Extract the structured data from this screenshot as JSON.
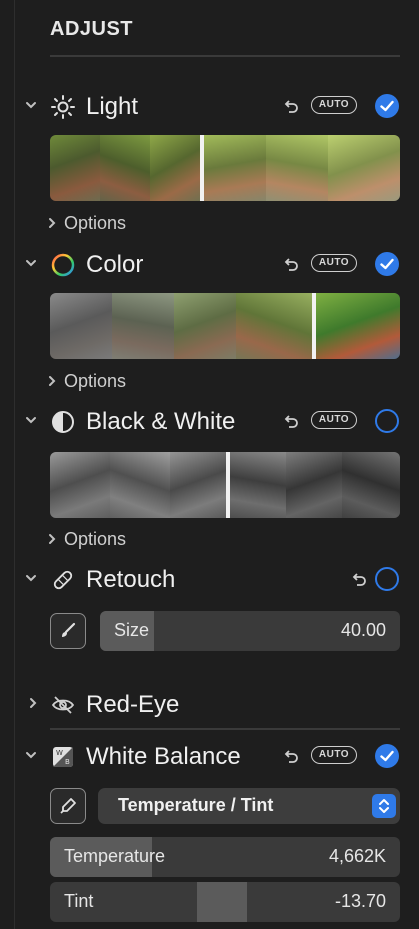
{
  "panel": {
    "title": "ADJUST"
  },
  "sections": {
    "light": {
      "label": "Light",
      "auto_label": "AUTO",
      "options_label": "Options"
    },
    "color": {
      "label": "Color",
      "auto_label": "AUTO",
      "options_label": "Options"
    },
    "bw": {
      "label": "Black & White",
      "auto_label": "AUTO",
      "options_label": "Options"
    },
    "retouch": {
      "label": "Retouch",
      "size_label": "Size",
      "size_value": "40.00"
    },
    "redeye": {
      "label": "Red-Eye"
    },
    "wb": {
      "label": "White Balance",
      "auto_label": "AUTO",
      "mode_selected": "Temperature / Tint",
      "temperature_label": "Temperature",
      "temperature_value": "4,662K",
      "tint_label": "Tint",
      "tint_value": "-13.70"
    }
  },
  "colors": {
    "accent": "#2f7ae8",
    "panel_bg": "#1e1e1e",
    "slider_bg": "#3a3a3a",
    "slider_fill": "#5b5b5b"
  },
  "levels": {
    "retouch_size_fill_fraction": 0.18,
    "temperature_fill_fraction": 0.29,
    "tint_marker_fraction": 0.42
  }
}
